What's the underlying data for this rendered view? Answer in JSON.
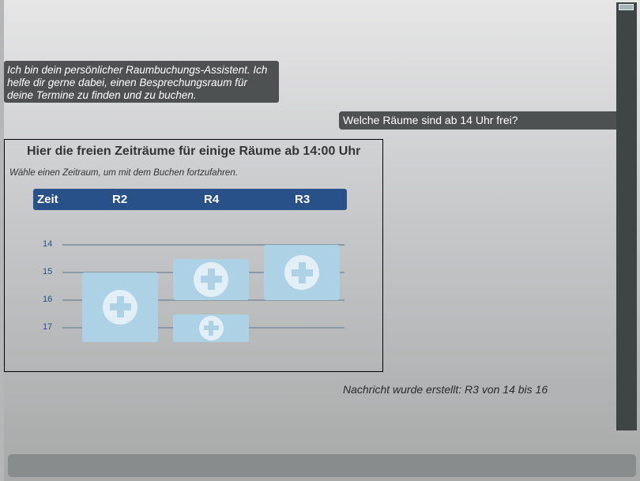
{
  "chat": {
    "bot_intro": "Ich bin dein persönlicher Raumbuchungs-Assistent. Ich helfe dir gerne dabei, einen Besprechungsraum für deine Termine zu finden und zu buchen.",
    "user_question": "Welche Räume sind ab 14 Uhr frei?",
    "confirmation": "Nachricht wurde erstellt: R3 von 14 bis 16"
  },
  "card": {
    "title": "Hier die freien Zeiträume für einige Räume ab 14:00 Uhr",
    "subtitle": "Wähle einen Zeitraum, um mit dem Buchen fortzufahren.",
    "header": {
      "time": "Zeit",
      "rooms": [
        "R2",
        "R4",
        "R3"
      ]
    },
    "hours": [
      "14",
      "15",
      "16",
      "17"
    ],
    "slots": [
      {
        "room": "R2",
        "from": 15,
        "to": 17.5
      },
      {
        "room": "R4",
        "from": 14.5,
        "to": 16
      },
      {
        "room": "R4",
        "from": 16.5,
        "to": 17.5
      },
      {
        "room": "R3",
        "from": 14,
        "to": 16
      }
    ]
  },
  "colors": {
    "header_bg": "#285189",
    "slot": "#add2e6",
    "bubble": "#4d5151"
  },
  "icons": {
    "slot_icon": "plus-circle-icon"
  }
}
